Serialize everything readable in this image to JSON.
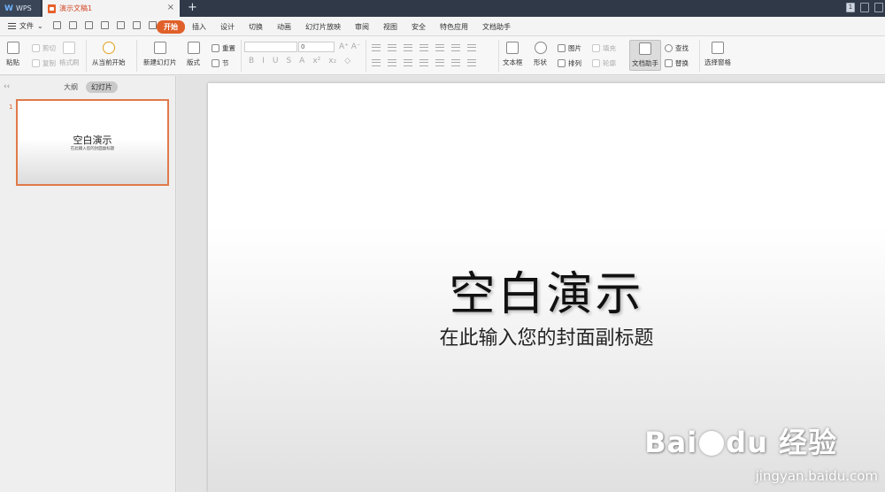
{
  "titlebar": {
    "app_tab": "WPS",
    "doc_tab": "演示文稿1",
    "close_glyph": "×",
    "add_glyph": "+",
    "window_count": "1"
  },
  "menubar": {
    "file_label": "文件",
    "tabs": [
      "开始",
      "插入",
      "设计",
      "切换",
      "动画",
      "幻灯片放映",
      "审阅",
      "视图",
      "安全",
      "特色应用",
      "文档助手"
    ]
  },
  "ribbon": {
    "paste": "粘贴",
    "cut": "剪切",
    "copy": "复制",
    "format_painter": "格式刷",
    "from_current": "从当前开始",
    "new_slide": "新建幻灯片",
    "layout": "版式",
    "reset": "重置",
    "section": "节",
    "font_size_value": "0",
    "font_bold": "B",
    "font_italic": "I",
    "font_underline": "U",
    "font_strike": "S",
    "font_color": "A",
    "textbox": "文本框",
    "shapes": "形状",
    "picture": "图片",
    "arrange": "排列",
    "fill": "填充",
    "outline": "轮廓",
    "doc_assistant": "文档助手",
    "find": "查找",
    "replace": "替换",
    "selection_pane": "选择窗格"
  },
  "left_panel": {
    "collapse_glyph": "‹‹",
    "tab_outline": "大纲",
    "tab_slides": "幻灯片",
    "slide_number": "1",
    "thumb_title": "空白演示",
    "thumb_subtitle": "在此输入您的封面副标题"
  },
  "slide": {
    "title": "空白演示",
    "subtitle": "在此输入您的封面副标题"
  },
  "watermark": {
    "brand": "Bai",
    "brand_end": "du 经验",
    "url": "jingyan.baidu.com"
  }
}
